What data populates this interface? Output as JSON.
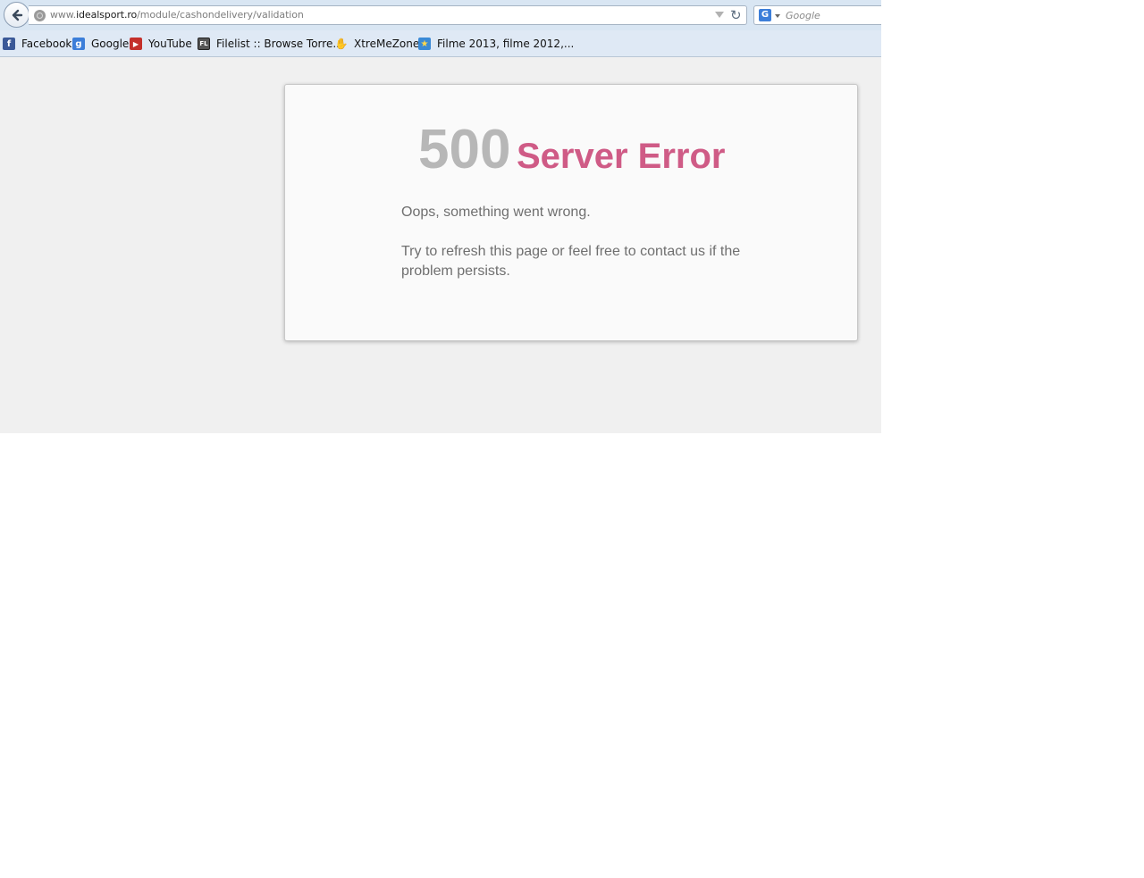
{
  "browser": {
    "url_prefix": "www.",
    "url_host": "idealsport.ro",
    "url_path": "/module/cashondelivery/validation",
    "search_engine_icon": "G",
    "search_placeholder": "Google"
  },
  "bookmarks": [
    {
      "label": "Facebook",
      "icon": "facebook-icon",
      "glyph": "f",
      "color": "#3b5998"
    },
    {
      "label": "Google",
      "icon": "google-icon",
      "glyph": "g",
      "color": "#3c7ed9"
    },
    {
      "label": "YouTube",
      "icon": "youtube-icon",
      "glyph": "▶",
      "color": "#c4302b"
    },
    {
      "label": "Filelist :: Browse Torre...",
      "icon": "filelist-icon",
      "glyph": "FL",
      "color": "#555555"
    },
    {
      "label": "XtreMeZone",
      "icon": "xtremezone-icon",
      "glyph": "✋",
      "color": "#333333"
    },
    {
      "label": "Filme 2013, filme 2012,...",
      "icon": "filme-icon",
      "glyph": "★",
      "color": "#3a8ad6"
    }
  ],
  "error": {
    "code": "500",
    "title": "Server Error",
    "message_line": "Oops, something went wrong.",
    "message_detail": "Try to refresh this page or feel free to contact us if the problem persists."
  },
  "colors": {
    "error_title": "#cf5b86",
    "error_code": "#b7b7b7",
    "message_text": "#6f6f6f",
    "page_background": "#f0f0f0"
  }
}
